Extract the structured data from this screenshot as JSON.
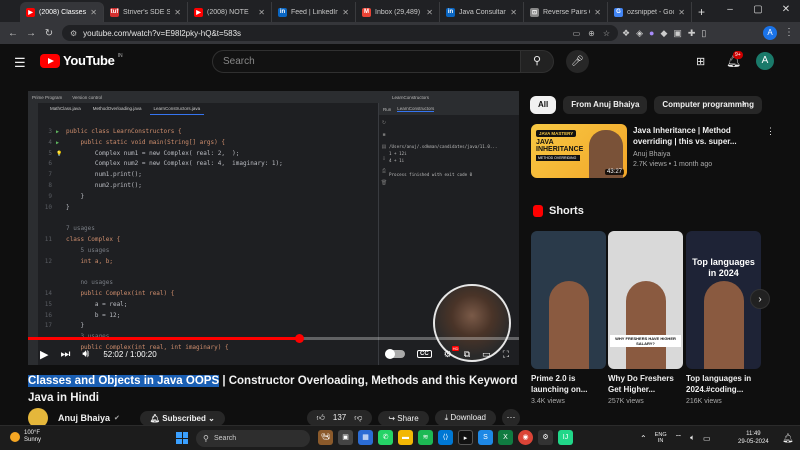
{
  "browser": {
    "tabs": [
      {
        "label": "(2008) Classes a",
        "color": "#ff0000",
        "glyph": "▶",
        "active": true
      },
      {
        "label": "Striver's SDE She",
        "color": "#d32f2f",
        "glyph": "tuf",
        "active": false
      },
      {
        "label": "(2008) NOTE",
        "color": "#ff0000",
        "glyph": "▶",
        "active": false
      },
      {
        "label": "Feed | LinkedIn",
        "color": "#0a66c2",
        "glyph": "in",
        "active": false
      },
      {
        "label": "Inbox (29,489)",
        "color": "#ea4335",
        "glyph": "M",
        "active": false
      },
      {
        "label": "Java Consultant",
        "color": "#0a66c2",
        "glyph": "in",
        "active": false
      },
      {
        "label": "Reverse Pairs Co",
        "color": "#888888",
        "glyph": "⊡",
        "active": false
      },
      {
        "label": "ozsnippet - Goo",
        "color": "#4285f4",
        "glyph": "G",
        "active": false
      }
    ],
    "new_tab": "+",
    "url": "youtube.com/watch?v=E98l2pky-hQ&t=583s",
    "profile_initial": "A"
  },
  "youtube": {
    "logo_text": "YouTube",
    "logo_country": "IN",
    "search_placeholder": "Search",
    "notif_count": "9+",
    "avatar_initial": "A"
  },
  "player": {
    "ide_menu": [
      "Prime Program",
      "Version control"
    ],
    "ide_run_config": "LearnConstructors",
    "ide_tabs": [
      "MathClass.java",
      "MethodOverloading.java",
      "LearnConstructors.java"
    ],
    "code_lines": [
      {
        "n": "3",
        "g": "▶",
        "t": "public class LearnConstructors {"
      },
      {
        "n": "4",
        "g": "▶",
        "t": "    public static void main(String[] args) {"
      },
      {
        "n": "5",
        "g": "💡",
        "t": "        Complex num1 = new Complex( real: 2,  );"
      },
      {
        "n": "6",
        "g": "",
        "t": "        Complex num2 = new Complex( real: 4,  imaginary: 1);"
      },
      {
        "n": "7",
        "g": "",
        "t": "        num1.print();"
      },
      {
        "n": "8",
        "g": "",
        "t": "        num2.print();"
      },
      {
        "n": "9",
        "g": "",
        "t": "    }"
      },
      {
        "n": "10",
        "g": "",
        "t": "}"
      },
      {
        "n": "",
        "g": "",
        "t": ""
      },
      {
        "n": "",
        "g": "",
        "t": "7 usages"
      },
      {
        "n": "11",
        "g": "",
        "t": "class Complex {"
      },
      {
        "n": "",
        "g": "",
        "t": "    5 usages"
      },
      {
        "n": "12",
        "g": "",
        "t": "    int a, b;"
      },
      {
        "n": "",
        "g": "",
        "t": ""
      },
      {
        "n": "",
        "g": "",
        "t": "    no usages"
      },
      {
        "n": "14",
        "g": "",
        "t": "    public Complex(int real) {"
      },
      {
        "n": "15",
        "g": "",
        "t": "        a = real;"
      },
      {
        "n": "16",
        "g": "",
        "t": "        b = 12;"
      },
      {
        "n": "17",
        "g": "",
        "t": "    }"
      },
      {
        "n": "",
        "g": "",
        "t": "    3 usages"
      },
      {
        "n": "",
        "g": "",
        "t": "    public Complex(int real, int imaginary) {"
      }
    ],
    "run_tab": "Run",
    "run_target": "LearnConstructors",
    "run_output": "/Users/anuj/.sdkman/candidates/java/11.0...\n1 + 12i\n4 + 1i\n\nProcess finished with exit code 0",
    "progress": 0.552,
    "time": "52:02 / 1:00:20",
    "hd_label": "HD",
    "cc_label": "CC"
  },
  "video": {
    "title_highlight": "Classes and Objects in Java OOPS",
    "title_rest": " | Constructor Overloading, Methods and this Keyword Java in Hindi",
    "channel": "Anuj Bhaiya",
    "subscribe": "Subscribed",
    "likes": "137",
    "share": "Share",
    "download": "Download"
  },
  "sidebar": {
    "chips": [
      "All",
      "From Anuj Bhaiya",
      "Computer programming"
    ],
    "rec": {
      "thumb_label": "JAVA MASTERY",
      "thumb_big": "JAVA INHERITANCE",
      "thumb_sub": "METHOD OVERRIDING",
      "duration": "43:27",
      "title": "Java Inheritance | Method overriding | this vs. super...",
      "channel": "Anuj Bhaiya",
      "meta": "2.7K views • 1 month ago"
    },
    "shorts_heading": "Shorts",
    "shorts": [
      {
        "title": "Prime 2.0 is launching on...",
        "views": "3.4K views",
        "color": "#2a3a4a"
      },
      {
        "title": "Why Do Freshers Get Higher...",
        "views": "257K views",
        "color": "#d9d9d9",
        "overlay": "WHY FRESHERS HAVE HIGHER SALARY?"
      },
      {
        "title": "Top languages in 2024.#coding...",
        "views": "216K views",
        "color": "#1e2336",
        "overlay": "Top languages in 2024"
      }
    ]
  },
  "taskbar": {
    "temp": "100°F",
    "weather": "Sunny",
    "search": "Search",
    "lang1": "ENG",
    "lang2": "IN",
    "time": "11:49",
    "date": "29-05-2024"
  },
  "colors": {
    "accent": "#ff0000",
    "highlight": "#1a5fb4"
  }
}
